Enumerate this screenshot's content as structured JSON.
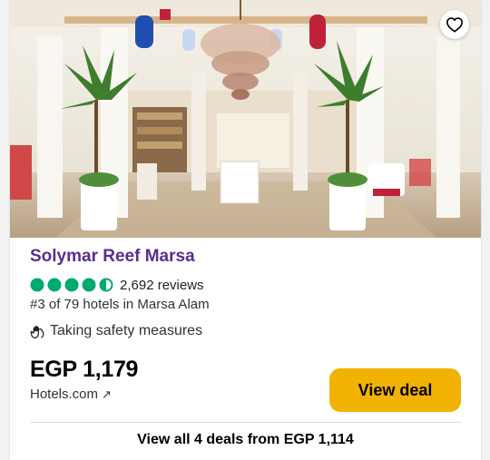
{
  "hotel": {
    "name": "Solymar Reef Marsa",
    "rating_bubbles": 4.5,
    "reviews": "2,692 reviews",
    "rank": "#3 of 79 hotels in Marsa Alam",
    "safety": "Taking safety measures"
  },
  "offer": {
    "price": "EGP 1,179",
    "provider": "Hotels.com",
    "provider_ext": "↗",
    "button_label": "View deal",
    "all_deals": "View all 4 deals from EGP 1,114"
  },
  "colors": {
    "hotel_name": "#5c2d91",
    "bubble_green": "#00aa6c",
    "deal_button": "#f2b203"
  },
  "icons": {
    "favorite": "heart-icon",
    "safety": "hands-icon",
    "external": "external-link-icon"
  }
}
